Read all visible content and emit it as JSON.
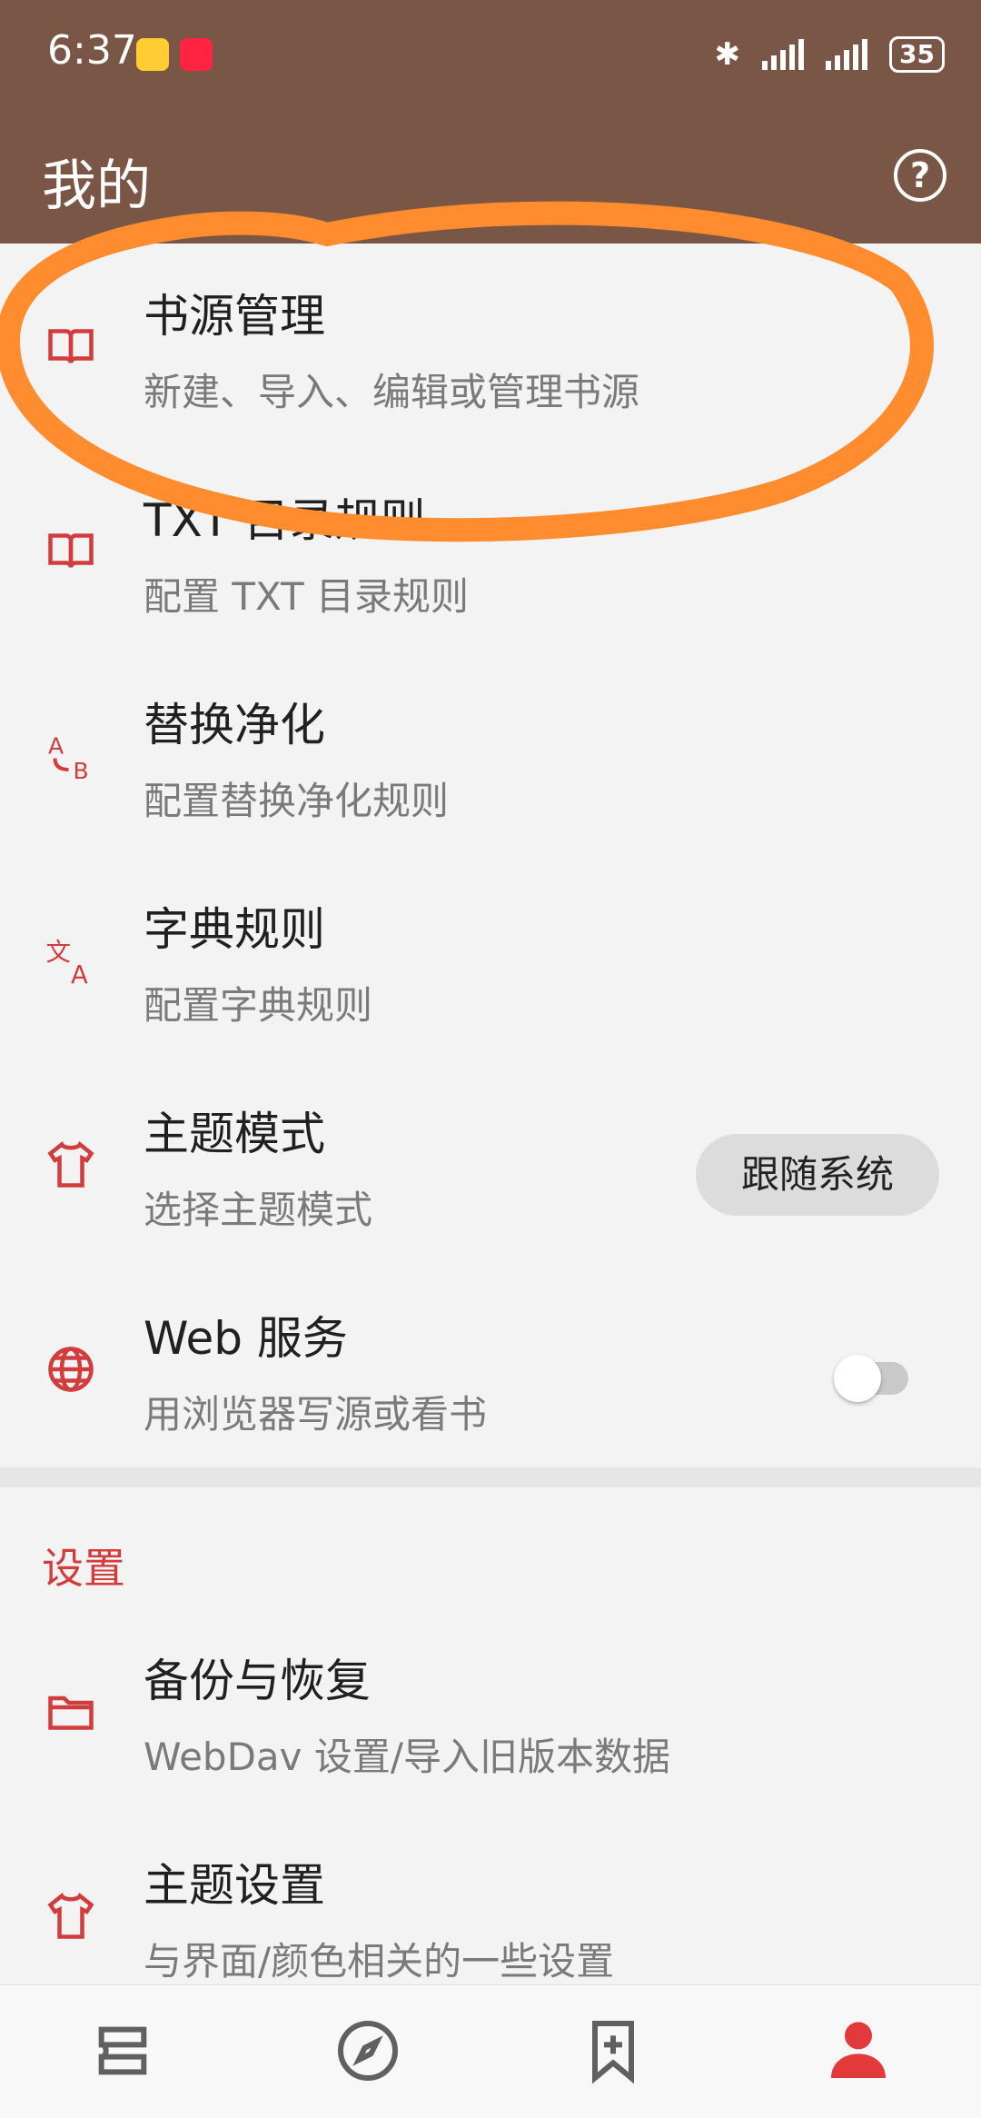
{
  "status_bar": {
    "time": "6:37",
    "battery": "35"
  },
  "app_bar": {
    "title": "我的"
  },
  "items": [
    {
      "title": "书源管理",
      "subtitle": "新建、导入、编辑或管理书源",
      "icon": "book-icon"
    },
    {
      "title": "TXT 目录规则",
      "subtitle": "配置 TXT 目录规则",
      "icon": "book-icon"
    },
    {
      "title": "替换净化",
      "subtitle": "配置替换净化规则",
      "icon": "replace-icon"
    },
    {
      "title": "字典规则",
      "subtitle": "配置字典规则",
      "icon": "translate-icon"
    },
    {
      "title": "主题模式",
      "subtitle": "选择主题模式",
      "icon": "shirt-icon",
      "value": "跟随系统"
    },
    {
      "title": "Web 服务",
      "subtitle": "用浏览器写源或看书",
      "icon": "globe-icon",
      "toggle": false
    }
  ],
  "settings": {
    "section_title": "设置",
    "items": [
      {
        "title": "备份与恢复",
        "subtitle": "WebDav 设置/导入旧版本数据",
        "icon": "folder-icon"
      },
      {
        "title": "主题设置",
        "subtitle": "与界面/颜色相关的一些设置",
        "icon": "shirt-icon"
      }
    ]
  },
  "bottom_nav": [
    {
      "icon": "bookshelf-icon",
      "active": false
    },
    {
      "icon": "compass-icon",
      "active": false
    },
    {
      "icon": "bookmark-add-icon",
      "active": false
    },
    {
      "icon": "profile-icon",
      "active": true
    }
  ],
  "colors": {
    "header": "#7a5646",
    "accent": "#d23c3c",
    "annotation": "#ff8c2e"
  }
}
